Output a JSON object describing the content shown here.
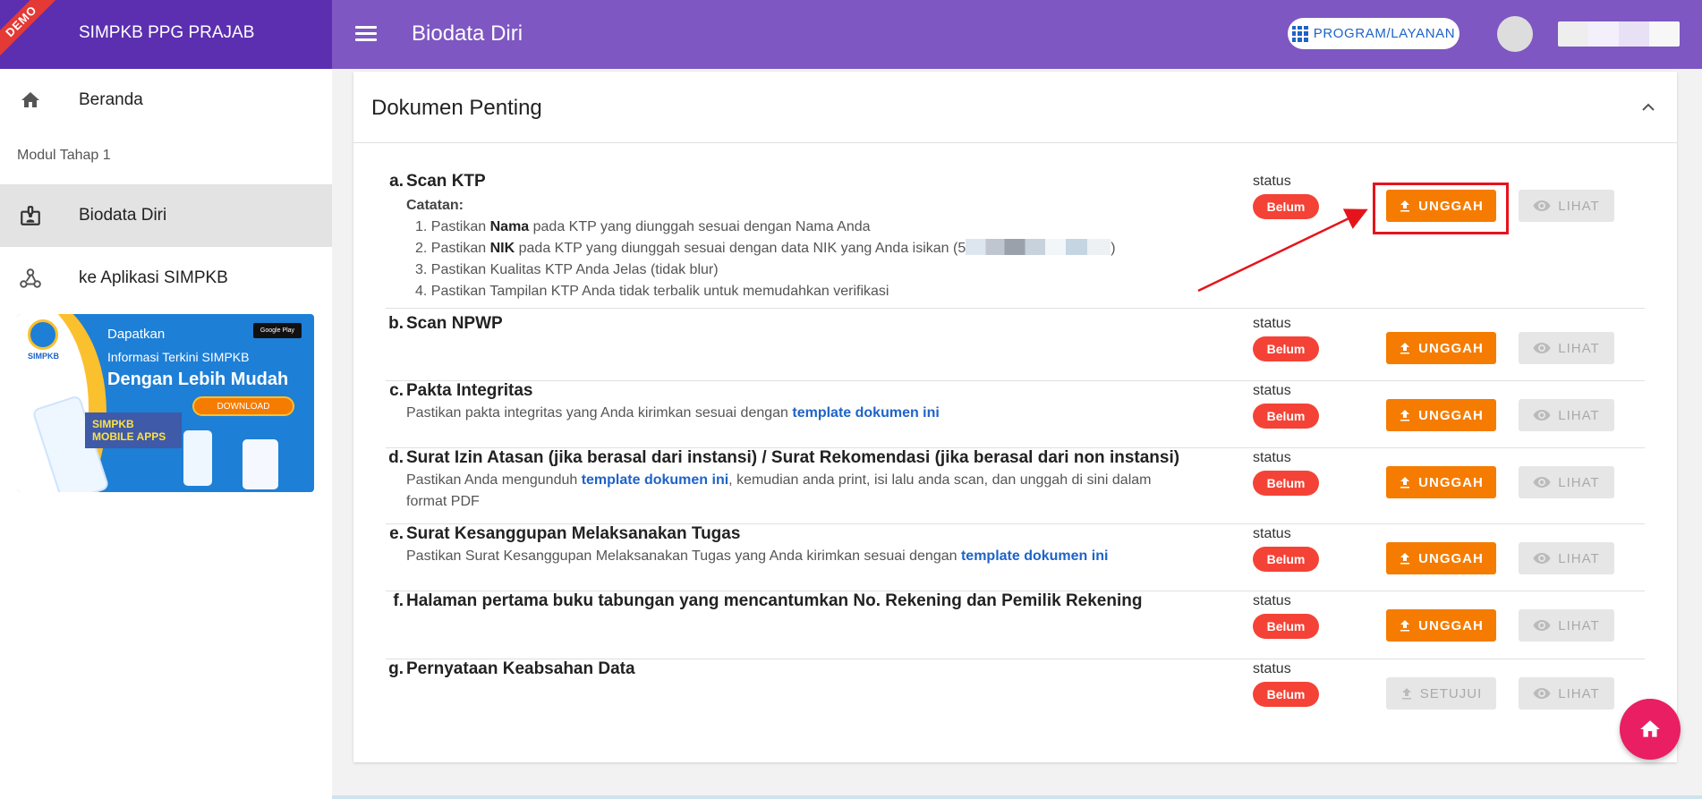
{
  "header": {
    "demo_ribbon": "DEMO",
    "app_title": "SIMPKB PPG PRAJAB",
    "page_title": "Biodata Diri",
    "program_button": "PROGRAM/LAYANAN"
  },
  "sidebar": {
    "items": [
      {
        "label": "Beranda",
        "icon": "home-icon"
      },
      {
        "label": "Biodata Diri",
        "icon": "badge-icon",
        "active": true
      },
      {
        "label": "ke Aplikasi SIMPKB",
        "icon": "webhook-icon"
      }
    ],
    "section_label": "Modul Tahap 1",
    "banner": {
      "logo_text": "SIMPKB",
      "line1": "Dapatkan",
      "line2": "Informasi Terkini SIMPKB",
      "line3": "Dengan Lebih Mudah",
      "store_badge": "Google Play",
      "download": "DOWNLOAD",
      "mobile_apps": "SIMPKB MOBILE APPS"
    }
  },
  "card": {
    "title": "Dokumen Penting",
    "status_label": "status",
    "status_value": "Belum",
    "upload_label": "UNGGAH",
    "approve_label": "SETUJUI",
    "view_label": "LIHAT",
    "catatan_label": "Catatan:",
    "ktp_notes": [
      {
        "pre": "1. Pastikan ",
        "bold": "Nama",
        "post": " pada KTP yang diunggah sesuai dengan Nama Anda"
      },
      {
        "pre": "2. Pastikan ",
        "bold": "NIK",
        "post": " pada KTP yang diunggah sesuai dengan data NIK yang Anda isikan ("
      },
      {
        "pre": "3. Pastikan Kualitas KTP Anda Jelas (tidak blur)",
        "bold": "",
        "post": ""
      },
      {
        "pre": "4. Pastikan Tampilan KTP Anda tidak terbalik untuk memudahkan verifikasi",
        "bold": "",
        "post": ""
      }
    ],
    "nik_partial": "5",
    "nik_close": ")",
    "link_text": "template dokumen ini",
    "documents": [
      {
        "letter": "a.",
        "title": "Scan KTP"
      },
      {
        "letter": "b.",
        "title": "Scan NPWP"
      },
      {
        "letter": "c.",
        "title": "Pakta Integritas",
        "desc_pre": "Pastikan pakta integritas yang Anda kirimkan sesuai dengan "
      },
      {
        "letter": "d.",
        "title": "Surat Izin Atasan (jika berasal dari instansi) / Surat Rekomendasi (jika berasal dari non instansi)",
        "desc_pre": "Pastikan Anda mengunduh ",
        "desc_post": ", kemudian anda print, isi lalu anda scan, dan unggah di sini dalam format PDF"
      },
      {
        "letter": "e.",
        "title": "Surat Kesanggupan Melaksanakan Tugas",
        "desc_pre": "Pastikan Surat Kesanggupan Melaksanakan Tugas yang Anda kirimkan sesuai dengan "
      },
      {
        "letter": "f.",
        "title": "Halaman pertama buku tabungan yang mencantumkan No. Rekening dan Pemilik Rekening"
      },
      {
        "letter": "g.",
        "title": "Pernyataan Keabsahan Data"
      }
    ]
  },
  "colors": {
    "brand": "#5b2fb0",
    "topbar": "#7e57c2",
    "upload": "#f57c00",
    "status_badge": "#f44336",
    "link": "#1e63c8",
    "fab": "#e91e63",
    "annotation": "#e5141c"
  }
}
